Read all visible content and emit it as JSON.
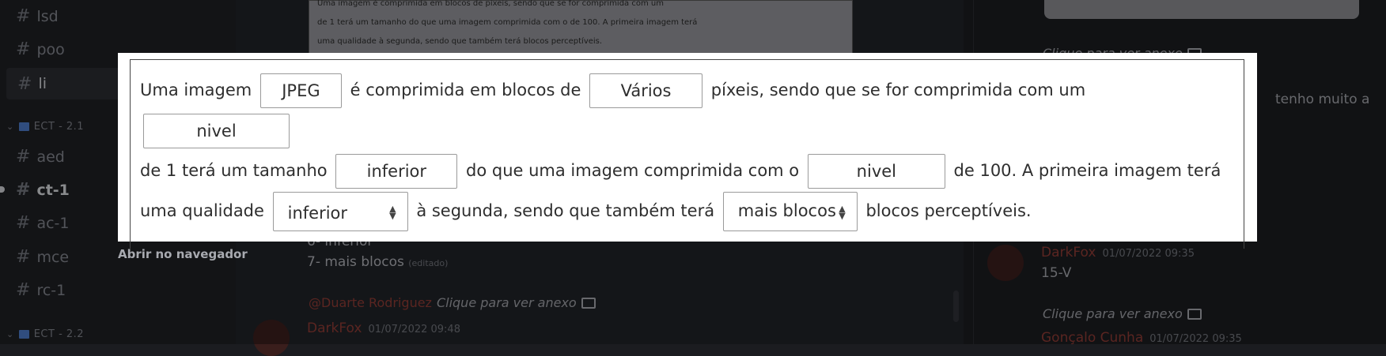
{
  "sidebar": {
    "channels_top": [
      {
        "name": "lsd"
      },
      {
        "name": "poo"
      },
      {
        "name": "li"
      }
    ],
    "category_1": "ECT - 2.1",
    "channels_mid": [
      {
        "name": "aed"
      },
      {
        "name": "ct-1"
      },
      {
        "name": "ac-1"
      },
      {
        "name": "mce"
      },
      {
        "name": "rc-1"
      }
    ],
    "category_2": "ECT - 2.2",
    "open_in_browser": "Abrir no navegador"
  },
  "chat": {
    "attachment_lines": [
      "Uma imagem          é comprimida em blocos de            píxeis, sendo que se for comprimida com um",
      "de 1 terá um tamanho              do que uma imagem comprimida com o              de 100. A primeira imagem terá",
      "uma qualidade                     à segunda, sendo que também terá                   blocos perceptíveis."
    ],
    "answer_6": "6- inferior",
    "answer_7": "7- mais blocos",
    "edited": "(editado)",
    "reply_mention": "@Duarte Rodriguez",
    "reply_text": "Clique para ver anexo",
    "author": "DarkFox",
    "timestamp": "01/07/2022 09:48"
  },
  "thread": {
    "reply_top": "Clique para ver anexo",
    "side_text": "tenho muito a",
    "author": "DarkFox",
    "timestamp": "01/07/2022 09:35",
    "message": "15-V",
    "reply_bottom": "Clique para ver anexo",
    "author2": "Gonçalo Cunha",
    "timestamp2": "01/07/2022 09:35"
  },
  "question": {
    "t1": "Uma imagem",
    "f1": "JPEG",
    "t2": "é comprimida em blocos de",
    "f2": "Vários",
    "t3": "píxeis, sendo que se for comprimida com um",
    "f3": "nivel",
    "t4": "de 1 terá um tamanho",
    "f4": "inferior",
    "t5": "do que uma imagem comprimida com o",
    "f5": "nivel",
    "t6": "de 100. A primeira imagem terá",
    "t7": "uma qualidade",
    "s1": "inferior",
    "t8": "à segunda, sendo que também terá",
    "s2": "mais blocos",
    "t9": "blocos perceptíveis."
  }
}
